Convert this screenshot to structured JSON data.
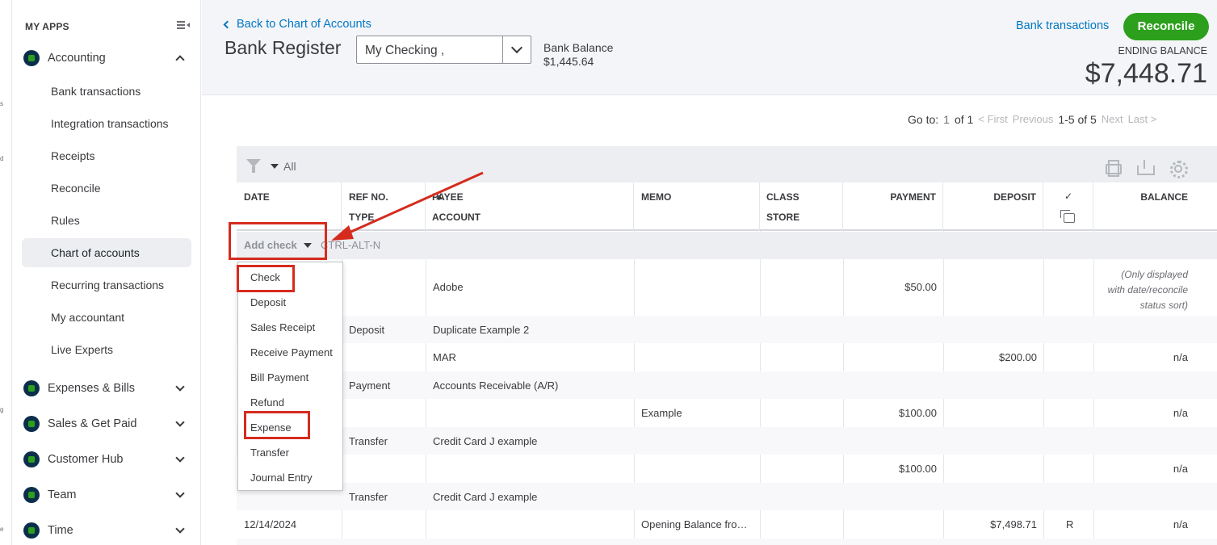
{
  "left_edge_fragments": [
    "s",
    "d",
    "g",
    "e"
  ],
  "sidebar": {
    "header": "MY APPS",
    "sections": [
      {
        "label": "Accounting",
        "icon": "accounting-icon",
        "expanded": true
      },
      {
        "label": "Expenses & Bills",
        "icon": "expenses-icon"
      },
      {
        "label": "Sales & Get Paid",
        "icon": "sales-icon"
      },
      {
        "label": "Customer Hub",
        "icon": "customer-hub-icon"
      },
      {
        "label": "Team",
        "icon": "team-icon"
      },
      {
        "label": "Time",
        "icon": "time-icon"
      }
    ],
    "accounting_items": [
      {
        "label": "Bank transactions"
      },
      {
        "label": "Integration transactions"
      },
      {
        "label": "Receipts"
      },
      {
        "label": "Reconcile"
      },
      {
        "label": "Rules"
      },
      {
        "label": "Chart of accounts",
        "active": true
      },
      {
        "label": "Recurring transactions"
      },
      {
        "label": "My accountant"
      },
      {
        "label": "Live Experts"
      }
    ]
  },
  "header": {
    "back_link": "Back to Chart of Accounts",
    "title": "Bank Register",
    "account_select": "My Checking      ,",
    "bank_balance_label": "Bank Balance",
    "bank_balance_value": "$1,445.64",
    "bank_transactions_link": "Bank transactions",
    "reconcile_button": "Reconcile",
    "ending_balance_label": "ENDING BALANCE",
    "ending_balance_value": "$7,448.71"
  },
  "pager": {
    "goto_label": "Go to:",
    "page": "1",
    "of": "of 1",
    "first": "< First",
    "previous": "Previous",
    "range": "1-5 of 5",
    "next": "Next",
    "last": "Last >"
  },
  "toolbar": {
    "filter_value": "All"
  },
  "columns": {
    "date": "DATE",
    "ref_no": "REF NO.",
    "type": "TYPE",
    "payee": "PAYEE",
    "account": "ACCOUNT",
    "memo": "MEMO",
    "class": "CLASS",
    "store": "STORE",
    "payment": "PAYMENT",
    "deposit": "DEPOSIT",
    "reconcile_mark": "✓",
    "balance": "BALANCE"
  },
  "add_row": {
    "label": "Add check",
    "shortcut": "CTRL-ALT-N"
  },
  "add_menu": [
    "Check",
    "Deposit",
    "Sales Receipt",
    "Receive Payment",
    "Bill Payment",
    "Refund",
    "Expense",
    "Transfer",
    "Journal Entry"
  ],
  "rows": [
    {
      "date": "",
      "type": "Deposit",
      "payee": "Adobe",
      "account": "Duplicate Example 2",
      "memo": "",
      "payment": "$50.00",
      "deposit": "",
      "status": "",
      "balance_note": "(Only displayed\nwith date/reconcile\nstatus sort)"
    },
    {
      "date": "",
      "type": "Payment",
      "payee": "MAR",
      "account": "Accounts Receivable (A/R)",
      "memo": "",
      "payment": "",
      "deposit": "$200.00",
      "status": "",
      "balance": "n/a"
    },
    {
      "date": "",
      "type": "Transfer",
      "payee": "",
      "account": "Credit Card J example",
      "memo": "Example",
      "payment": "$100.00",
      "deposit": "",
      "status": "",
      "balance": "n/a"
    },
    {
      "date": "",
      "type": "Transfer",
      "payee": "",
      "account": "Credit Card J example",
      "memo": "",
      "payment": "$100.00",
      "deposit": "",
      "status": "",
      "balance": "n/a"
    },
    {
      "date": "12/14/2024",
      "type": "",
      "payee": "",
      "account": "",
      "memo": "Opening Balance fro…",
      "payment": "",
      "deposit": "$7,498.71",
      "status": "R",
      "balance": "n/a"
    }
  ],
  "colors": {
    "accent_green": "#2ca01c",
    "link_blue": "#0077c5",
    "annotation_red": "#d52b1e"
  }
}
